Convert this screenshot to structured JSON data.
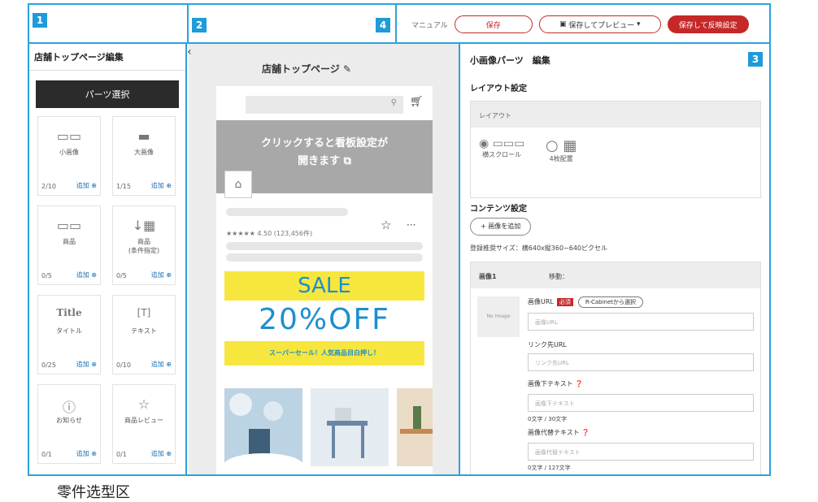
{
  "markers": {
    "m1": "1",
    "m2": "2",
    "m3": "3",
    "m4": "4"
  },
  "topbar": {
    "manual": "マニュアル",
    "save": "保存",
    "save_preview": "保存してプレビュー",
    "save_publish": "保存して反映設定"
  },
  "left": {
    "title": "店舗トップページ編集",
    "parts_button": "パーツ選択",
    "parts": [
      {
        "label": "小画像",
        "count": "2/10",
        "add": "追加",
        "icon": "small-image-icon"
      },
      {
        "label": "大画像",
        "count": "1/15",
        "add": "追加",
        "icon": "large-image-icon"
      },
      {
        "label": "商品",
        "count": "0/5",
        "add": "追加",
        "icon": "product-icon"
      },
      {
        "label": "商品\n(条件指定)",
        "count": "0/5",
        "add": "追加",
        "icon": "product-list-icon"
      },
      {
        "label": "タイトル",
        "count": "0/25",
        "add": "追加",
        "icon": "title-icon"
      },
      {
        "label": "テキスト",
        "count": "0/10",
        "add": "追加",
        "icon": "text-icon"
      },
      {
        "label": "お知らせ",
        "count": "0/1",
        "add": "追加",
        "icon": "info-icon"
      },
      {
        "label": "商品レビュー",
        "count": "0/1",
        "add": "追加",
        "icon": "star-icon"
      }
    ]
  },
  "preview": {
    "title": "店舗トップページ",
    "banner_line1": "クリックすると看板設定が",
    "banner_line2": "開きます",
    "rating": "★★★★★ 4.50 (123,456件)",
    "sale": "SALE",
    "off": "20%OFF",
    "sale_sub": "スーパーセール！人気商品目白押し！"
  },
  "right": {
    "title": "小画像パーツ　編集",
    "layout_section": "レイアウト設定",
    "layout_head": "レイアウト",
    "opt1": "横スクロール",
    "opt2": "4枚配置",
    "content_section": "コンテンツ設定",
    "add_image": "+ 画像を追加",
    "hint": "登録推奨サイズ：横640x縦360~640ピクセル",
    "img_head": "画像1",
    "move": "移動：",
    "no_image": "No Image",
    "img_url_label": "画像URL",
    "required": "必須",
    "rcab": "R-Cabinetから選択",
    "img_url_ph": "画像URL",
    "link_label": "リンク先URL",
    "link_ph": "リンク先URL",
    "caption_label": "画像下テキスト",
    "caption_ph": "画像下テキスト",
    "caption_count": "0文字 / 30文字",
    "alt_label": "画像代替テキスト",
    "alt_ph": "画像代替テキスト",
    "alt_count": "0文字 / 127文字"
  },
  "footer_caption": "零件选型区"
}
